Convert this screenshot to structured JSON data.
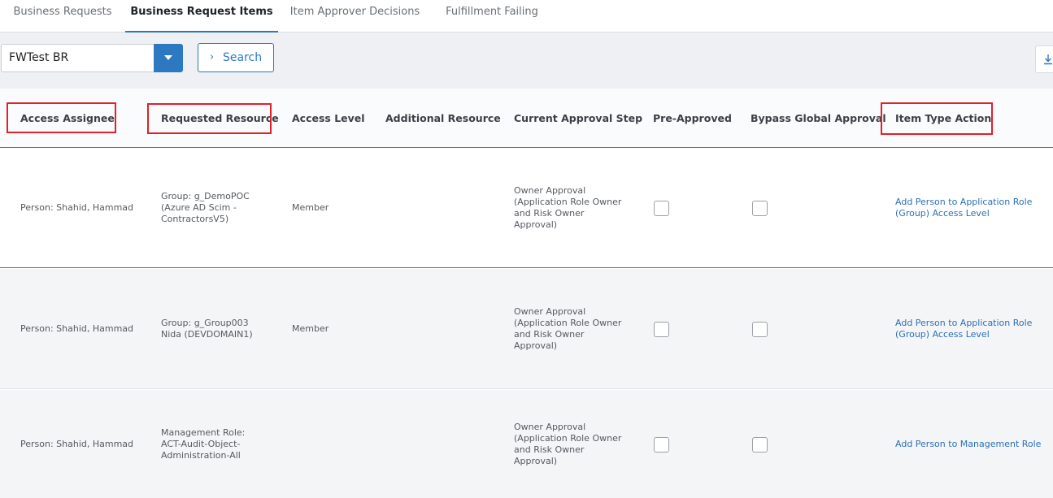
{
  "tabs": [
    {
      "label": "Business Requests",
      "active": false
    },
    {
      "label": "Business Request Items",
      "active": true
    },
    {
      "label": "Item Approver Decisions",
      "active": false
    },
    {
      "label": "Fulfillment Failing",
      "active": false
    }
  ],
  "toolbar": {
    "select_value": "FWTest BR",
    "search_label": "Search",
    "download_icon": "download-icon"
  },
  "columns": [
    "Access Assignee",
    "Requested Resource",
    "Access Level",
    "Additional Resource",
    "Current Approval Step",
    "Pre-Approved",
    "Bypass Global Approval",
    "Item Type Action"
  ],
  "highlighted_columns": [
    "Access Assignee",
    "Requested Resource",
    "Item Type Action"
  ],
  "highlight_color": "#e0202a",
  "accent_color": "#2d79c1",
  "rows": [
    {
      "assignee": "Person: Shahid, Hammad",
      "resource": [
        "Group: g_DemoPOC",
        "(Azure AD Scim -",
        "ContractorsV5)"
      ],
      "access_level": "Member",
      "additional_resource": "",
      "approval_step": [
        "Owner Approval",
        "(Application Role Owner",
        "and Risk Owner",
        "Approval)"
      ],
      "pre_approved": false,
      "bypass_global": false,
      "action": [
        "Add Person to Application Role",
        "(Group) Access Level"
      ]
    },
    {
      "assignee": "Person: Shahid, Hammad",
      "resource": [
        "Group: g_Group003",
        "Nida (DEVDOMAIN1)"
      ],
      "access_level": "Member",
      "additional_resource": "",
      "approval_step": [
        "Owner Approval",
        "(Application Role Owner",
        "and Risk Owner",
        "Approval)"
      ],
      "pre_approved": false,
      "bypass_global": false,
      "action": [
        "Add Person to Application Role",
        "(Group) Access Level"
      ]
    },
    {
      "assignee": "Person: Shahid, Hammad",
      "resource": [
        "Management Role:",
        "ACT-Audit-Object-",
        "Administration-All"
      ],
      "access_level": "",
      "additional_resource": "",
      "approval_step": [
        "Owner Approval",
        "(Application Role Owner",
        "and Risk Owner",
        "Approval)"
      ],
      "pre_approved": false,
      "bypass_global": false,
      "action": [
        "Add Person to Management Role"
      ]
    }
  ]
}
